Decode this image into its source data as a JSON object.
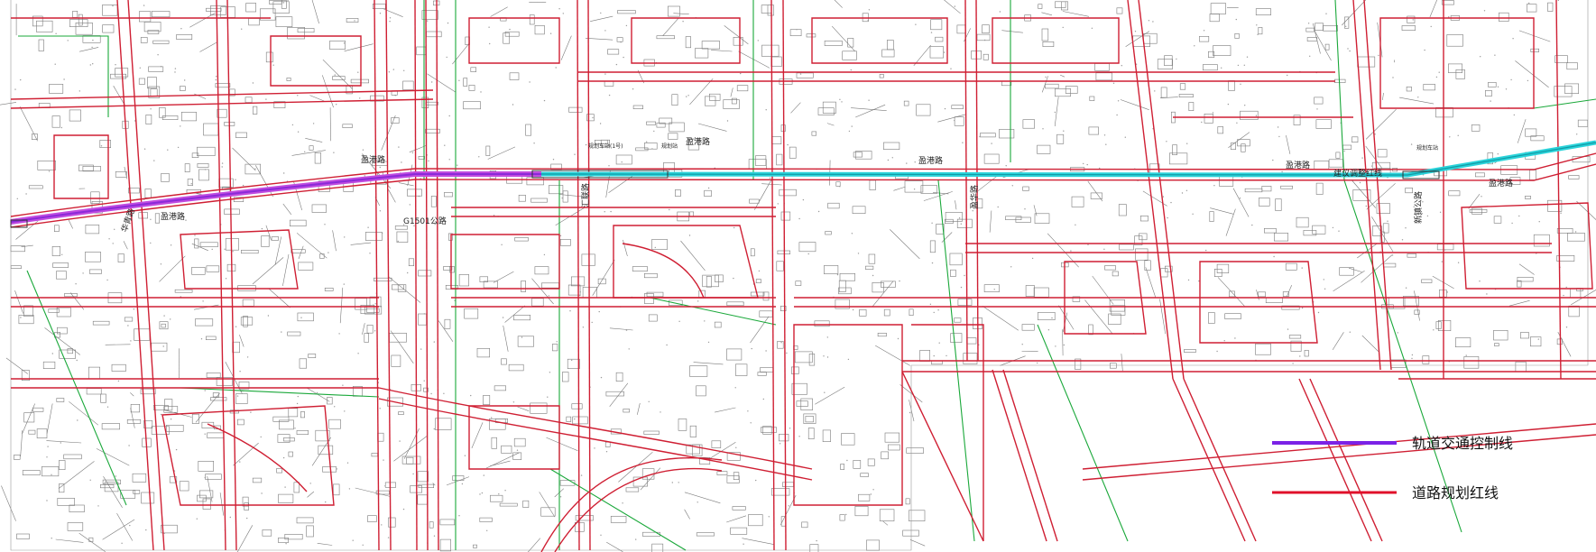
{
  "colors": {
    "rail_control_line": "#7b22e6",
    "road_red_line": "#e0102a",
    "existing_line": "#c7253a",
    "green_boundary": "#1aa83a",
    "cyan_corridor": "#2ad3da",
    "magenta_corridor": "#c04be0",
    "base_linework": "#6b6b6b"
  },
  "road_labels": {
    "yinggang_1": "盈港路",
    "yinggang_2": "盈港路",
    "yinggang_3": "盈港路",
    "yinggang_4": "盈港路",
    "yinggang_5": "盈港路",
    "yinggang_6": "盈港路",
    "g1501": "G1501公路",
    "huaqing": "华青路",
    "huilian": "汇联路",
    "yinghua": "盈华路",
    "jiancheng": "建议调整红线",
    "xinzhen": "新镇公路",
    "station1": "规划车站(1号)",
    "station2": "规划站",
    "station3": "规划车站"
  },
  "legend": {
    "items": [
      {
        "label": "轨道交通控制线",
        "color": "#7b22e6"
      },
      {
        "label": "道路规划红线",
        "color": "#e0102a"
      }
    ]
  }
}
